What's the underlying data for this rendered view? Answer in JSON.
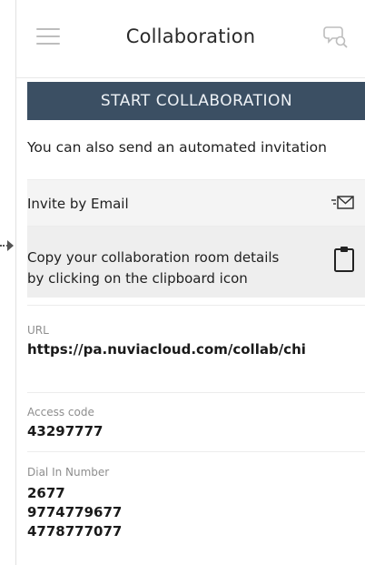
{
  "header": {
    "title": "Collaboration"
  },
  "start_button": {
    "label": "START COLLABORATION"
  },
  "invite": {
    "note": "You can also send an automated invitation",
    "email_label": "Invite by Email"
  },
  "copy": {
    "line1": "Copy your collaboration room details",
    "line2": "by clicking on the clipboard icon"
  },
  "fields": {
    "url": {
      "label": "URL",
      "value": "https://pa.nuviacloud.com/collab/chi"
    },
    "access": {
      "label": "Access code",
      "value": "43297777"
    },
    "dial": {
      "label": "Dial In Number",
      "numbers": [
        "2677",
        "9774779677",
        "4778777077"
      ]
    }
  },
  "icons": {
    "menu": "hamburger-menu-icon",
    "chat": "chat-search-icon",
    "mail": "envelope-icon",
    "clipboard": "clipboard-icon",
    "pointer": "arrow-right-icon"
  },
  "colors": {
    "start_button_bg": "#3b4f63",
    "start_button_text": "#eef2f6",
    "row_bg": "#f4f4f4",
    "copy_bg": "#eeeeee"
  }
}
